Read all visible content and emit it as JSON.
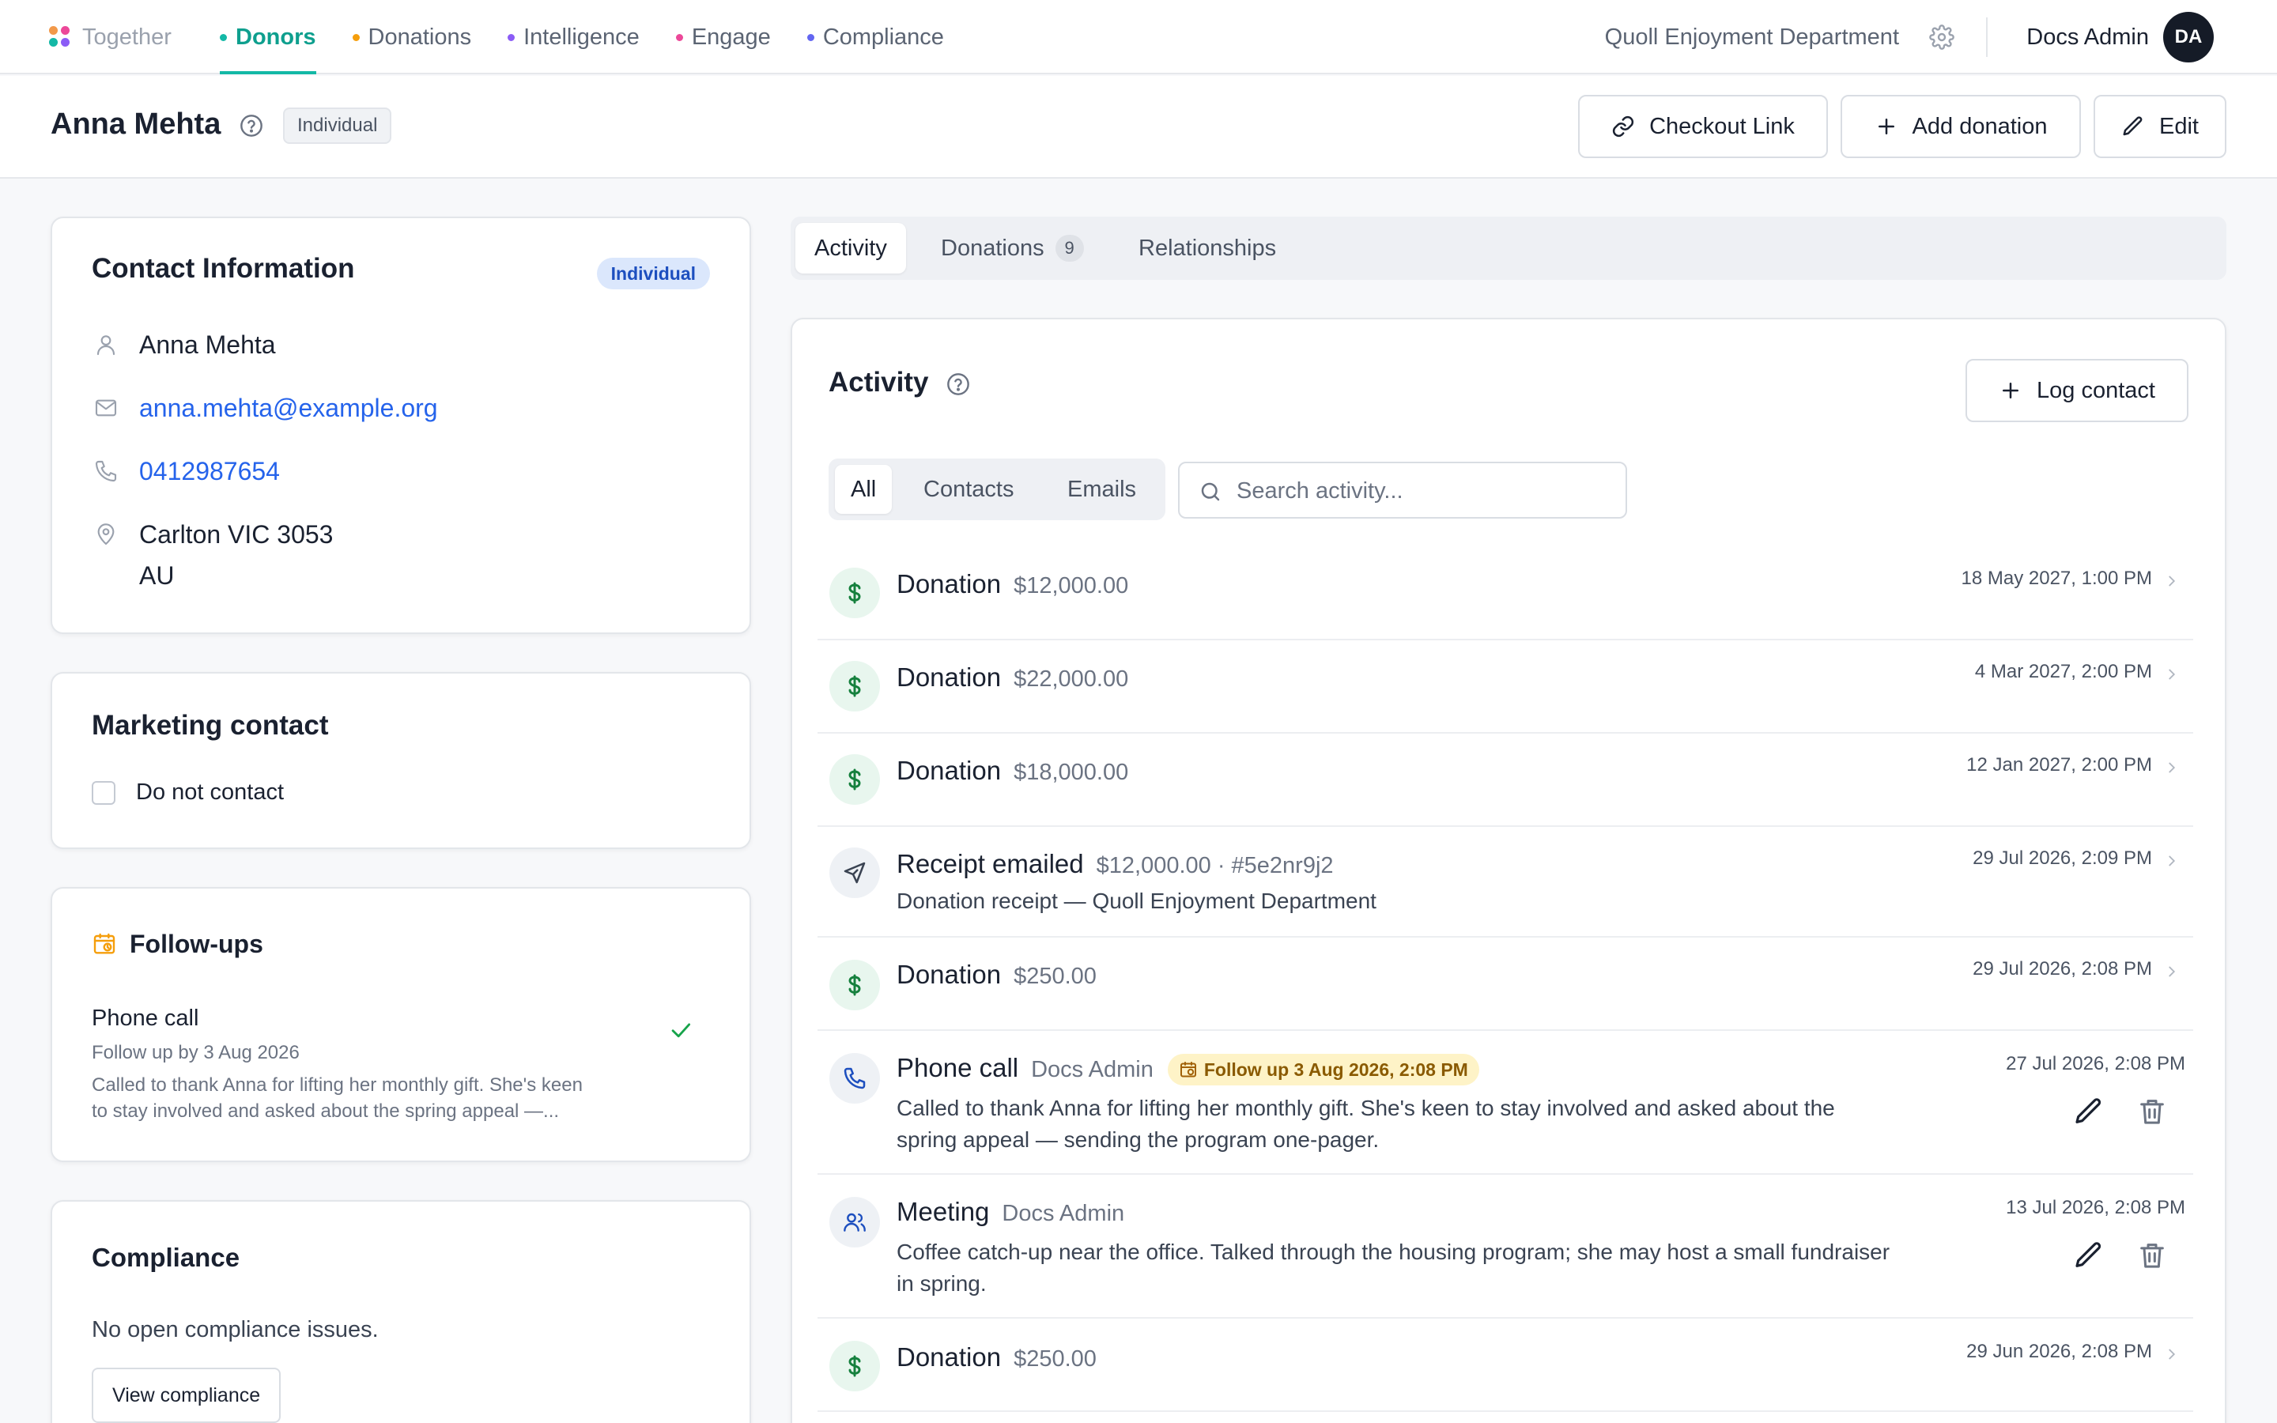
{
  "nav": {
    "brand": "Together",
    "tabs": [
      {
        "label": "Donors",
        "color": "#14b8a6",
        "active": true
      },
      {
        "label": "Donations",
        "color": "#f59e0b"
      },
      {
        "label": "Intelligence",
        "color": "#8b5cf6"
      },
      {
        "label": "Engage",
        "color": "#ec4899"
      },
      {
        "label": "Compliance",
        "color": "#6366f1"
      }
    ],
    "org": "Quoll Enjoyment Department",
    "user": "Docs Admin",
    "avatar_initials": "DA"
  },
  "header": {
    "title": "Anna Mehta",
    "badge": "Individual",
    "buttons": {
      "checkout": "Checkout Link",
      "add_donation": "Add donation",
      "edit": "Edit"
    }
  },
  "contact": {
    "title": "Contact Information",
    "badge": "Individual",
    "name": "Anna Mehta",
    "email": "anna.mehta@example.org",
    "phone": "0412987654",
    "address_line1": "Carlton VIC 3053",
    "address_line2": "AU"
  },
  "marketing": {
    "title": "Marketing contact",
    "do_not_contact_label": "Do not contact",
    "do_not_contact": false
  },
  "followups": {
    "title": "Follow-ups",
    "item": {
      "title": "Phone call",
      "due": "Follow up by 3 Aug 2026",
      "note_line1": "Called to thank Anna for lifting her monthly gift. She's keen",
      "note_line2": "to stay involved and asked about the spring appeal —..."
    }
  },
  "compliance": {
    "title": "Compliance",
    "status": "No open compliance issues.",
    "button": "View compliance"
  },
  "tabs": {
    "activity": "Activity",
    "donations": "Donations",
    "donations_count": "9",
    "relationships": "Relationships"
  },
  "activity": {
    "title": "Activity",
    "log_button": "Log contact",
    "filters": {
      "all": "All",
      "contacts": "Contacts",
      "emails": "Emails"
    },
    "search_placeholder": "Search activity...",
    "rows": [
      {
        "title": "Donation",
        "meta": "$12,000.00",
        "date": "18 May 2027, 1:00 PM"
      },
      {
        "title": "Donation",
        "meta": "$22,000.00",
        "date": "4 Mar 2027, 2:00 PM"
      },
      {
        "title": "Donation",
        "meta": "$18,000.00",
        "date": "12 Jan 2027, 2:00 PM"
      },
      {
        "title": "Receipt emailed",
        "meta": "$12,000.00 · #5e2nr9j2",
        "desc": "Donation receipt — Quoll Enjoyment Department",
        "date": "29 Jul 2026, 2:09 PM"
      },
      {
        "title": "Donation",
        "meta": "$250.00",
        "date": "29 Jul 2026, 2:08 PM"
      },
      {
        "title": "Phone call",
        "meta": "Docs Admin",
        "badge": "Follow up 3 Aug 2026, 2:08 PM",
        "desc_line1": "Called to thank Anna for lifting her monthly gift. She's keen to stay involved and asked about the",
        "desc_line2": "spring appeal — sending the program one-pager.",
        "date": "27 Jul 2026, 2:08 PM"
      },
      {
        "title": "Meeting",
        "meta": "Docs Admin",
        "desc_line1": "Coffee catch-up near the office. Talked through the housing program; she may host a small fundraiser",
        "desc_line2": "in spring.",
        "date": "13 Jul 2026, 2:08 PM"
      },
      {
        "title": "Donation",
        "meta": "$250.00",
        "date": "29 Jun 2026, 2:08 PM"
      }
    ]
  }
}
